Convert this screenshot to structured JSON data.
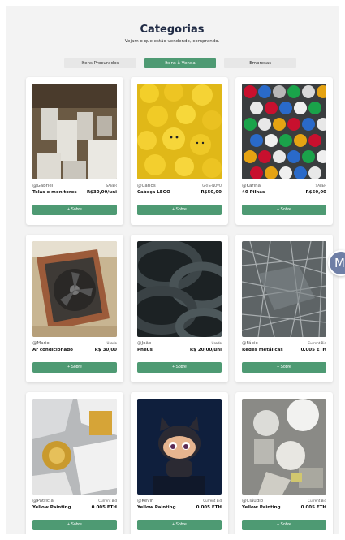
{
  "header": {
    "title": "Categorias",
    "subtitle": "Vejam o que estão vendendo, comprando."
  },
  "tabs": [
    {
      "label": "Itens Procurados",
      "active": false
    },
    {
      "label": "Itens à Venda",
      "active": true
    },
    {
      "label": "Empresas",
      "active": false
    }
  ],
  "cards": [
    {
      "user": "@Gabriel",
      "type": "SABER",
      "name": "Telas e monitores",
      "price": "R$30,00/uni",
      "button": "+ Sobre",
      "image": "monitors"
    },
    {
      "user": "@Carlos",
      "type": "GRTS-NOVO",
      "name": "Cabeça LEGO",
      "price": "R$50,00",
      "button": "+ Sobre",
      "image": "lego"
    },
    {
      "user": "@Karina",
      "type": "SABER",
      "name": "40 Pilhas",
      "price": "R$50,00",
      "button": "+ Sobre",
      "image": "batteries"
    },
    {
      "user": "@Mario",
      "type": "Usado",
      "name": "Ar condicionado",
      "price": "R$ 30,00",
      "button": "+ Sobre",
      "image": "aircon"
    },
    {
      "user": "@João",
      "type": "Usado",
      "name": "Pneus",
      "price": "R$ 20,00/uni",
      "button": "+ Sobre",
      "image": "tires"
    },
    {
      "user": "@Fábio",
      "type": "Current Bid",
      "name": "Redes metálicas",
      "price": "0.005 ETH",
      "button": "+ Sobre",
      "image": "metal"
    },
    {
      "user": "@Patricia",
      "type": "Current Bid",
      "name": "Yellow Painting",
      "price": "0.005 ETH",
      "button": "+ Sobre",
      "image": "cans"
    },
    {
      "user": "@Kevin",
      "type": "Current Bid",
      "name": "Yellow Painting",
      "price": "0.005 ETH",
      "button": "+ Sobre",
      "image": "octocat"
    },
    {
      "user": "@Cláudio",
      "type": "Current Bid",
      "name": "Yellow Painting",
      "price": "0.005 ETH",
      "button": "+ Sobre",
      "image": "bulbs"
    }
  ],
  "avatar": {
    "initial": "M",
    "color": "#6f7fa6"
  },
  "colors": {
    "accent": "#4e9a73",
    "background": "#f3f3f3",
    "title": "#1f2a44"
  }
}
